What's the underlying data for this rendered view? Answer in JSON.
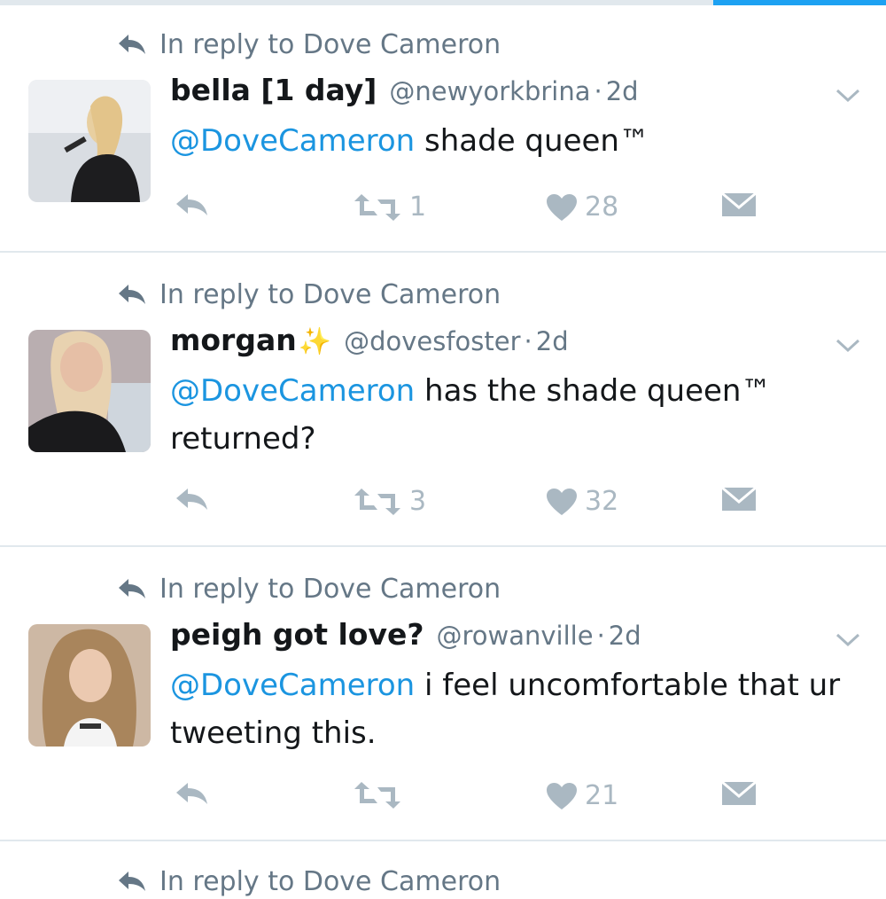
{
  "reply_prefix": "In reply to Dove Cameron",
  "colors": {
    "accent": "#1da1f2",
    "mention": "#1b95e0",
    "secondary_text": "#657786",
    "action_icons": "#aab8c2",
    "divider": "#e1e8ed"
  },
  "tweets": [
    {
      "name": "bella [1 day]",
      "handle": "@newyorkbrina",
      "time": "2d",
      "mention": "@DoveCameron",
      "text": " shade queen™",
      "retweets": "1",
      "likes": "28"
    },
    {
      "name": "morgan",
      "emoji": "✨",
      "handle": "@dovesfoster",
      "time": "2d",
      "mention": "@DoveCameron",
      "text": " has the shade queen™ returned?",
      "retweets": "3",
      "likes": "32"
    },
    {
      "name": "peigh got love?",
      "handle": "@rowanville",
      "time": "2d",
      "mention": "@DoveCameron",
      "text": " i feel uncomfortable that ur tweeting this.",
      "retweets": "",
      "likes": "21"
    }
  ],
  "partial_reply_prefix": "In reply to Dove Cameron"
}
